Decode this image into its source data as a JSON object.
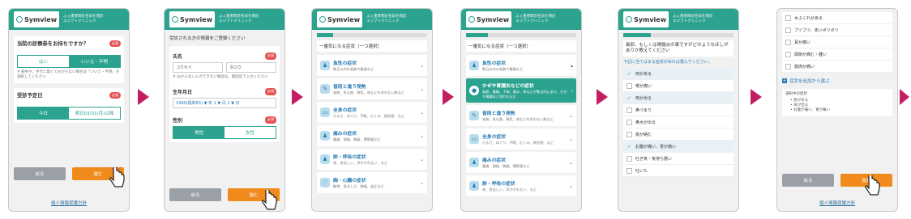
{
  "header": {
    "logo": "Symview",
    "subtitle": "ふぇ患者問診名前を問診\nエジプトクリニック",
    "subtitle_short": "ふぇ患者問診名前\nエジプトクリニック"
  },
  "screen1": {
    "question1": "当院の診察券をお持ちですか？",
    "required": "必須",
    "option_yes": "はい",
    "option_no": "いいえ・不明",
    "note": "# 紛失や、手元に無くて分からない場合は「いいえ・不明」を選択してください",
    "question2": "受診予定日",
    "date_today": "今日",
    "date_tomorrow": "明日03/31(月)以降",
    "back": "戻る",
    "next": "進む",
    "privacy": "個人情報保護方針"
  },
  "screen2": {
    "intro": "受診される方の情報をご登録ください",
    "name_label": "氏名",
    "name_first": "コウセイ",
    "name_last": "タロウ",
    "name_note": "# 分からない入力できない場合は、無回答で入力ください",
    "dob_label": "生年月日",
    "dob_value": "1990(昭和65) ▼ 年  1 ▼ 月  1 ▼ 日",
    "sex_label": "性別",
    "male": "男性",
    "female": "女性",
    "back": "戻る",
    "next": "進む"
  },
  "screen3": {
    "progress": 0.15,
    "prompt": "一番気になる症状（一つ選択）",
    "categories": [
      {
        "title": "急性の症状",
        "desc": "数日以内の発熱や腹痛など"
      },
      {
        "title": "普段と違う発熱",
        "desc": "発熱、急な熱、寒気、咳などを伴わない熱など"
      },
      {
        "title": "全身の症状",
        "desc": "だるさ、ほてり、不眠、むくみ、倦怠感、など"
      },
      {
        "title": "痛みの症状",
        "desc": "腹痛、頭痛、胸痛、関節痛など"
      },
      {
        "title": "肺・呼吸の症状",
        "desc": "咳、息苦しい、声がかれない、など"
      },
      {
        "title": "胸・心臓の症状",
        "desc": "動悸、息苦しさ、胸痛、血圧など"
      }
    ]
  },
  "screen4": {
    "progress": 0.2,
    "prompt": "一番気になる症状（一つ選択）",
    "selected_title": "かぜや胃腸炎などの症状",
    "selected_desc": "発熱、腹痛、下痢、鼻水、咳などが数日内にあり、かぜや胃腸炎と思われる方",
    "categories": [
      {
        "title": "急性の症状",
        "desc": "数日以内の発熱や腹痛など"
      },
      {
        "title": "普段と違う発熱",
        "desc": "発熱、急な熱、寒気、咳などを伴わない熱など"
      },
      {
        "title": "全身の症状",
        "desc": "だるさ、ほてり、不眠、むくみ、倦怠感、など"
      },
      {
        "title": "痛みの症状",
        "desc": "腹痛、頭痛、胸痛、関節痛など"
      },
      {
        "title": "肺・呼吸の症状",
        "desc": "咳、息苦しい、声がかれない、など"
      }
    ]
  },
  "screen5": {
    "progress": 0.25,
    "question": "風邪、もしくは胃腸炎の事ですがどのようなほしがありか教えてください",
    "hint": "下記に当てはまる症状があれば選んでください。",
    "items": [
      {
        "label": "熱がある",
        "checked": true
      },
      {
        "label": "喉が痛い",
        "checked": false
      },
      {
        "label": "咳が出る",
        "checked": true
      },
      {
        "label": "鼻づまり",
        "checked": false
      },
      {
        "label": "鼻水が出る",
        "checked": false
      },
      {
        "label": "痰が絡む",
        "checked": false
      },
      {
        "label": "お腹が痛い、胃が痛い",
        "checked": true
      },
      {
        "label": "吐き気・気持ち悪い",
        "checked": false
      },
      {
        "label": "吐いた",
        "checked": false
      }
    ]
  },
  "screen6": {
    "items": [
      "水ぶくれがある",
      "ブツブツ、赤いポツポツ",
      "耳が痛い",
      "関節が痛む・腫い",
      "筋肉が痛い"
    ],
    "expand_link": "症状を追加から選ぶ",
    "summary_title": "選択中の症状",
    "summary_items": [
      "• 熱がある",
      "• 咳が出る",
      "• お腹が痛い、胃が痛い"
    ],
    "back": "戻る",
    "next": "進む",
    "privacy": "個人情報保護方針"
  },
  "colors": {
    "teal": "#2ba38f",
    "orange": "#f08a1c",
    "arrow": "#c41e63"
  }
}
